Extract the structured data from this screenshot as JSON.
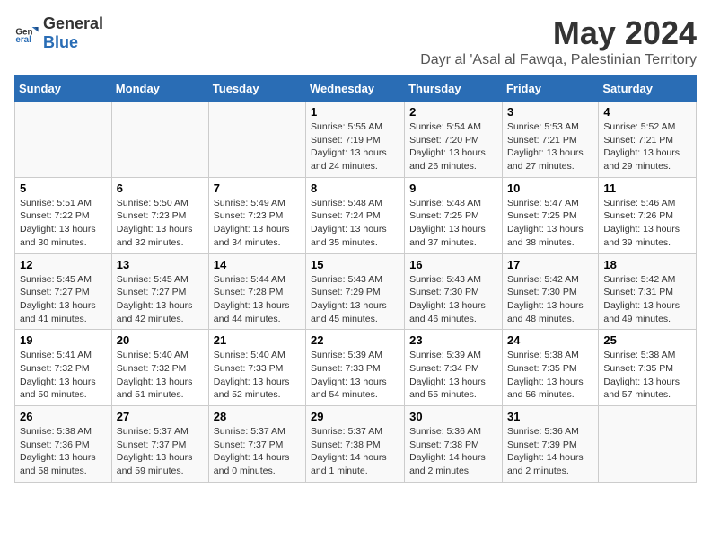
{
  "logo": {
    "text_general": "General",
    "text_blue": "Blue"
  },
  "title": "May 2024",
  "subtitle": "Dayr al 'Asal al Fawqa, Palestinian Territory",
  "days_of_week": [
    "Sunday",
    "Monday",
    "Tuesday",
    "Wednesday",
    "Thursday",
    "Friday",
    "Saturday"
  ],
  "weeks": [
    [
      {
        "day": "",
        "info": ""
      },
      {
        "day": "",
        "info": ""
      },
      {
        "day": "",
        "info": ""
      },
      {
        "day": "1",
        "info": "Sunrise: 5:55 AM\nSunset: 7:19 PM\nDaylight: 13 hours\nand 24 minutes."
      },
      {
        "day": "2",
        "info": "Sunrise: 5:54 AM\nSunset: 7:20 PM\nDaylight: 13 hours\nand 26 minutes."
      },
      {
        "day": "3",
        "info": "Sunrise: 5:53 AM\nSunset: 7:21 PM\nDaylight: 13 hours\nand 27 minutes."
      },
      {
        "day": "4",
        "info": "Sunrise: 5:52 AM\nSunset: 7:21 PM\nDaylight: 13 hours\nand 29 minutes."
      }
    ],
    [
      {
        "day": "5",
        "info": "Sunrise: 5:51 AM\nSunset: 7:22 PM\nDaylight: 13 hours\nand 30 minutes."
      },
      {
        "day": "6",
        "info": "Sunrise: 5:50 AM\nSunset: 7:23 PM\nDaylight: 13 hours\nand 32 minutes."
      },
      {
        "day": "7",
        "info": "Sunrise: 5:49 AM\nSunset: 7:23 PM\nDaylight: 13 hours\nand 34 minutes."
      },
      {
        "day": "8",
        "info": "Sunrise: 5:48 AM\nSunset: 7:24 PM\nDaylight: 13 hours\nand 35 minutes."
      },
      {
        "day": "9",
        "info": "Sunrise: 5:48 AM\nSunset: 7:25 PM\nDaylight: 13 hours\nand 37 minutes."
      },
      {
        "day": "10",
        "info": "Sunrise: 5:47 AM\nSunset: 7:25 PM\nDaylight: 13 hours\nand 38 minutes."
      },
      {
        "day": "11",
        "info": "Sunrise: 5:46 AM\nSunset: 7:26 PM\nDaylight: 13 hours\nand 39 minutes."
      }
    ],
    [
      {
        "day": "12",
        "info": "Sunrise: 5:45 AM\nSunset: 7:27 PM\nDaylight: 13 hours\nand 41 minutes."
      },
      {
        "day": "13",
        "info": "Sunrise: 5:45 AM\nSunset: 7:27 PM\nDaylight: 13 hours\nand 42 minutes."
      },
      {
        "day": "14",
        "info": "Sunrise: 5:44 AM\nSunset: 7:28 PM\nDaylight: 13 hours\nand 44 minutes."
      },
      {
        "day": "15",
        "info": "Sunrise: 5:43 AM\nSunset: 7:29 PM\nDaylight: 13 hours\nand 45 minutes."
      },
      {
        "day": "16",
        "info": "Sunrise: 5:43 AM\nSunset: 7:30 PM\nDaylight: 13 hours\nand 46 minutes."
      },
      {
        "day": "17",
        "info": "Sunrise: 5:42 AM\nSunset: 7:30 PM\nDaylight: 13 hours\nand 48 minutes."
      },
      {
        "day": "18",
        "info": "Sunrise: 5:42 AM\nSunset: 7:31 PM\nDaylight: 13 hours\nand 49 minutes."
      }
    ],
    [
      {
        "day": "19",
        "info": "Sunrise: 5:41 AM\nSunset: 7:32 PM\nDaylight: 13 hours\nand 50 minutes."
      },
      {
        "day": "20",
        "info": "Sunrise: 5:40 AM\nSunset: 7:32 PM\nDaylight: 13 hours\nand 51 minutes."
      },
      {
        "day": "21",
        "info": "Sunrise: 5:40 AM\nSunset: 7:33 PM\nDaylight: 13 hours\nand 52 minutes."
      },
      {
        "day": "22",
        "info": "Sunrise: 5:39 AM\nSunset: 7:33 PM\nDaylight: 13 hours\nand 54 minutes."
      },
      {
        "day": "23",
        "info": "Sunrise: 5:39 AM\nSunset: 7:34 PM\nDaylight: 13 hours\nand 55 minutes."
      },
      {
        "day": "24",
        "info": "Sunrise: 5:38 AM\nSunset: 7:35 PM\nDaylight: 13 hours\nand 56 minutes."
      },
      {
        "day": "25",
        "info": "Sunrise: 5:38 AM\nSunset: 7:35 PM\nDaylight: 13 hours\nand 57 minutes."
      }
    ],
    [
      {
        "day": "26",
        "info": "Sunrise: 5:38 AM\nSunset: 7:36 PM\nDaylight: 13 hours\nand 58 minutes."
      },
      {
        "day": "27",
        "info": "Sunrise: 5:37 AM\nSunset: 7:37 PM\nDaylight: 13 hours\nand 59 minutes."
      },
      {
        "day": "28",
        "info": "Sunrise: 5:37 AM\nSunset: 7:37 PM\nDaylight: 14 hours\nand 0 minutes."
      },
      {
        "day": "29",
        "info": "Sunrise: 5:37 AM\nSunset: 7:38 PM\nDaylight: 14 hours\nand 1 minute."
      },
      {
        "day": "30",
        "info": "Sunrise: 5:36 AM\nSunset: 7:38 PM\nDaylight: 14 hours\nand 2 minutes."
      },
      {
        "day": "31",
        "info": "Sunrise: 5:36 AM\nSunset: 7:39 PM\nDaylight: 14 hours\nand 2 minutes."
      },
      {
        "day": "",
        "info": ""
      }
    ]
  ]
}
